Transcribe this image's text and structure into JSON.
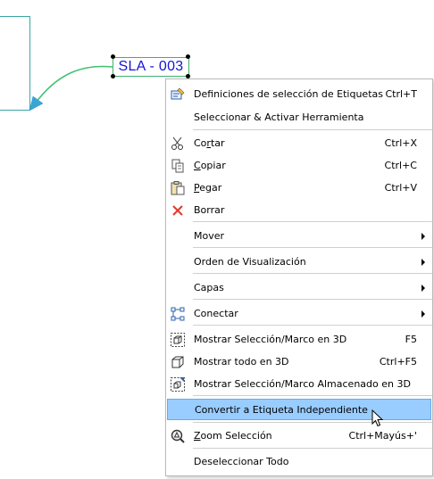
{
  "canvas": {
    "label_text": "SLA - 003"
  },
  "menu": {
    "items": [
      {
        "label": "Definiciones de selección de Etiquetas",
        "shortcut": "Ctrl+T",
        "icon": "label-settings-icon"
      },
      {
        "label": "Seleccionar & Activar Herramienta",
        "shortcut": ""
      },
      {
        "label_pre": "Co",
        "label_ul": "r",
        "label_post": "tar",
        "shortcut": "Ctrl+X",
        "icon": "scissors-icon"
      },
      {
        "label_pre": "",
        "label_ul": "C",
        "label_post": "opiar",
        "shortcut": "Ctrl+C",
        "icon": "copy-icon"
      },
      {
        "label_pre": "",
        "label_ul": "P",
        "label_post": "egar",
        "shortcut": "Ctrl+V",
        "icon": "paste-icon"
      },
      {
        "label": "Borrar",
        "shortcut": "",
        "icon": "delete-x-icon"
      },
      {
        "label": "Mover",
        "submenu": true
      },
      {
        "label": "Orden de Visualización",
        "submenu": true
      },
      {
        "label": "Capas",
        "submenu": true
      },
      {
        "label": "Conectar",
        "submenu": true,
        "icon": "connect-icon"
      },
      {
        "label": "Mostrar Selección/Marco en 3D",
        "shortcut": "F5",
        "icon": "show-selection-3d-icon"
      },
      {
        "label": "Mostrar todo en 3D",
        "shortcut": "Ctrl+F5",
        "icon": "cube-3d-icon"
      },
      {
        "label": "Mostrar Selección/Marco Almacenado en 3D",
        "shortcut": "",
        "icon": "stored-selection-3d-icon"
      },
      {
        "label": "Convertir a Etiqueta Independiente",
        "shortcut": "",
        "highlighted": true
      },
      {
        "label_pre": "",
        "label_ul": "Z",
        "label_post": "oom Selección",
        "shortcut": "Ctrl+Mayús+'",
        "icon": "zoom-selection-icon"
      },
      {
        "label": "Deseleccionar Todo",
        "shortcut": ""
      }
    ]
  },
  "colors": {
    "highlight": "#99ccff",
    "label_text": "#1414d8",
    "leader": "#40c070",
    "delete": "#e23b2b"
  }
}
